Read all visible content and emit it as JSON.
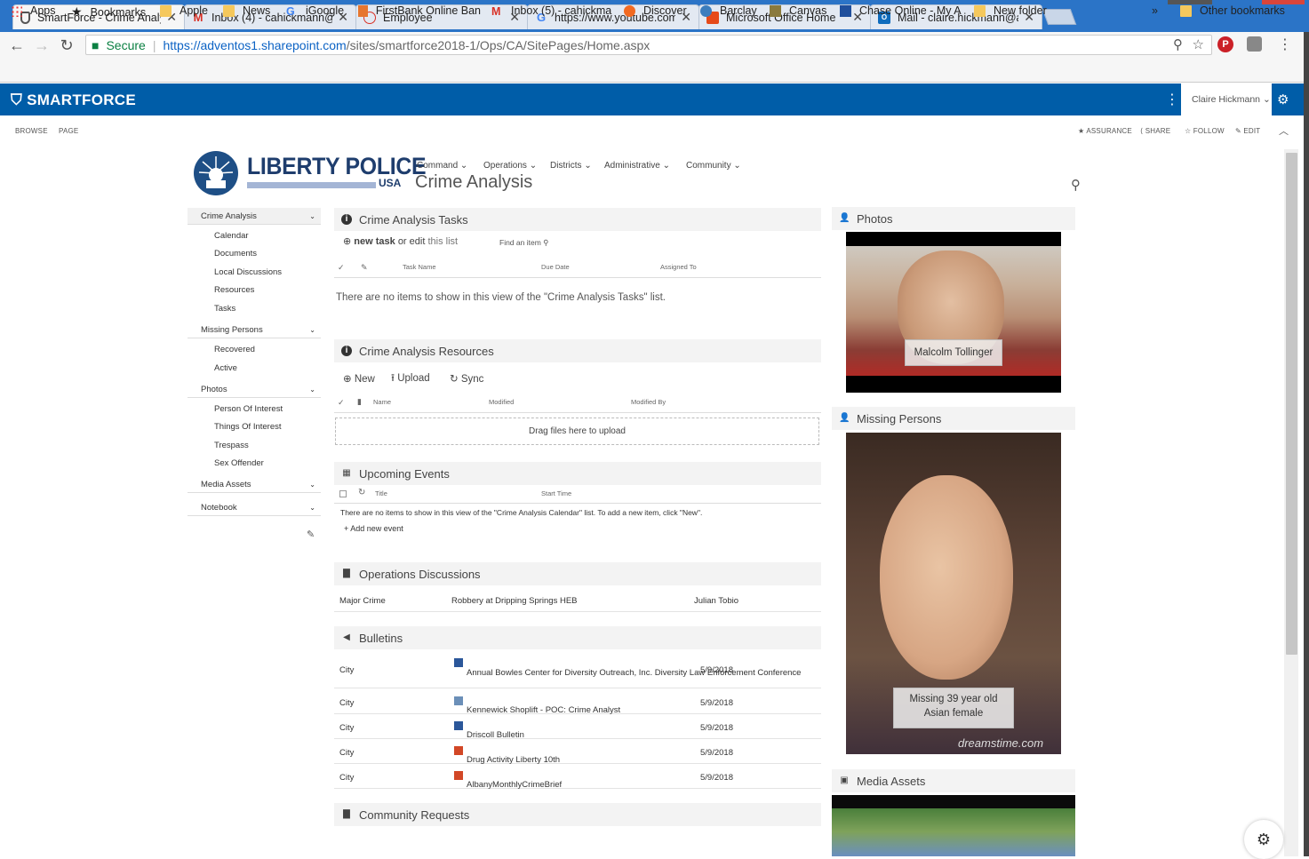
{
  "browser": {
    "tabs": [
      {
        "title": "SmartForce - Crime Analy",
        "icon": "shield-icon"
      },
      {
        "title": "Inbox (4) - cahickmann@",
        "icon": "gmail-icon"
      },
      {
        "title": "Employee",
        "icon": "circle-icon"
      },
      {
        "title": "https://www.youtube.com",
        "icon": "google-icon"
      },
      {
        "title": "Microsoft Office Home",
        "icon": "office-icon"
      },
      {
        "title": "Mail - claire.hickmann@a",
        "icon": "outlook-icon"
      }
    ],
    "secure_label": "Secure",
    "url_host": "https://adventos1.sharepoint.com",
    "url_path": "/sites/smartforce2018-1/Ops/CA/SitePages/Home.aspx",
    "bookmarks": [
      "Apps",
      "Bookmarks",
      "Apple",
      "News",
      "iGoogle",
      "FirstBank Online Ban",
      "Inbox (5) - cahickma",
      "Discover",
      "Barclay",
      "Canvas",
      "Chase Online - My A",
      "New folder"
    ],
    "overflow": "»",
    "other_bookmarks": "Other bookmarks"
  },
  "suite": {
    "logo": "SMARTFORCE",
    "user": "Claire Hickmann"
  },
  "ribbon": {
    "browse": "BROWSE",
    "page": "PAGE",
    "assurance": "ASSURANCE",
    "share": "SHARE",
    "follow": "FOLLOW",
    "edit": "EDIT"
  },
  "site": {
    "title": "LIBERTY POLICE",
    "sub": "USA",
    "page_title": "Crime Analysis",
    "topnav": [
      "Command",
      "Operations",
      "Districts",
      "Administrative",
      "Community"
    ]
  },
  "leftnav": [
    {
      "label": "Crime Analysis",
      "items": [
        "Calendar",
        "Documents",
        "Local Discussions",
        "Resources",
        "Tasks"
      ]
    },
    {
      "label": "Missing Persons",
      "items": [
        "Recovered",
        "Active"
      ]
    },
    {
      "label": "Photos",
      "items": [
        "Person Of Interest",
        "Things Of Interest",
        "Trespass",
        "Sex Offender"
      ]
    },
    {
      "label": "Media Assets",
      "items": []
    },
    {
      "label": "Notebook",
      "items": []
    }
  ],
  "tasks": {
    "title": "Crime Analysis Tasks",
    "new_task": "new task",
    "or_edit": "or",
    "edit": "edit",
    "this_list": "this list",
    "find": "Find an item",
    "cols": [
      "Task Name",
      "Due Date",
      "Assigned To"
    ],
    "empty": "There are no items to show in this view of the \"Crime Analysis Tasks\" list."
  },
  "resources": {
    "title": "Crime Analysis Resources",
    "new": "New",
    "upload": "Upload",
    "sync": "Sync",
    "cols": [
      "Name",
      "Modified",
      "Modified By"
    ],
    "drop": "Drag files here to upload"
  },
  "events": {
    "title": "Upcoming Events",
    "cols": [
      "Title",
      "Start Time"
    ],
    "empty": "There are no items to show in this view of the \"Crime Analysis Calendar\" list. To add a new item, click \"New\".",
    "add": "Add new event"
  },
  "discussions": {
    "title": "Operations Discussions",
    "rows": [
      {
        "cat": "Major Crime",
        "subject": "Robbery at Dripping Springs HEB",
        "author": "Julian Tobio"
      }
    ]
  },
  "bulletins": {
    "title": "Bulletins",
    "rows": [
      {
        "cat": "City",
        "title": "Annual Bowles Center for Diversity Outreach, Inc. Diversity Law Enforcement Conference",
        "date": "5/9/2018",
        "type": "doc"
      },
      {
        "cat": "City",
        "title": "Kennewick Shoplift - POC: Crime Analyst",
        "date": "5/9/2018",
        "type": "img"
      },
      {
        "cat": "City",
        "title": "Driscoll Bulletin",
        "date": "5/9/2018",
        "type": "doc"
      },
      {
        "cat": "City",
        "title": "Drug Activity Liberty 10th",
        "date": "5/9/2018",
        "type": "pdf"
      },
      {
        "cat": "City",
        "title": "AlbanyMonthlyCrimeBrief",
        "date": "5/9/2018",
        "type": "pdf"
      }
    ]
  },
  "community": {
    "title": "Community Requests"
  },
  "photos": {
    "title": "Photos",
    "caption": "Malcolm Tollinger"
  },
  "missing": {
    "title": "Missing Persons",
    "caption1": "Missing 39 year old",
    "caption2": "Asian female",
    "watermark": "dreamstime.com"
  },
  "media": {
    "title": "Media Assets"
  },
  "colors": {
    "suite": "#005da8",
    "tabbar": "#2b74c7",
    "brand": "#1e3d6d"
  }
}
